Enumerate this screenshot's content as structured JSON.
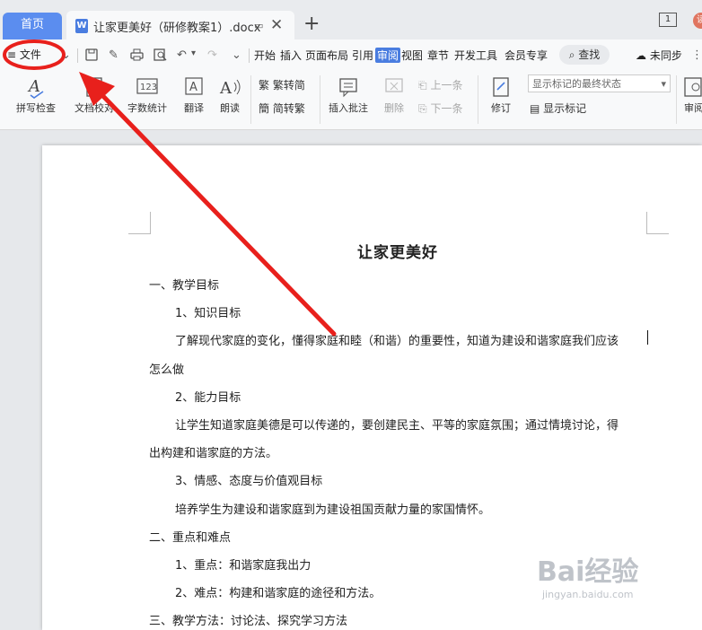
{
  "tabbar": {
    "home_label": "首页",
    "doc_icon_letter": "W",
    "doc_title": "让家更美好（研修教案1）.docx",
    "new_tab": "+",
    "window_count": "1",
    "avatar_letter": "读"
  },
  "menubar": {
    "file_label": "≡ 文件",
    "tabs": [
      "开始",
      "插入",
      "页面布局",
      "引用",
      "审阅",
      "视图",
      "章节",
      "开发工具",
      "会员专享"
    ],
    "search_label": "查找",
    "sync_label": "未同步"
  },
  "ribbon": {
    "spellcheck": "拼写检查",
    "doc_proof": "文档校对",
    "word_count": "字数统计",
    "translate": "翻译",
    "read_aloud": "朗读",
    "trad_to_simp": "繁转简",
    "simp_to_trad": "简转繁",
    "insert_comment": "插入批注",
    "delete": "删除",
    "prev": "上一条",
    "next": "下一条",
    "revise": "修订",
    "markup_state": "显示标记的最终状态",
    "show_markup": "显示标记",
    "review": "审阅"
  },
  "document": {
    "title": "让家更美好",
    "lines": [
      "一、教学目标",
      "1、知识目标",
      "了解现代家庭的变化，懂得家庭和睦（和谐）的重要性，知道为建设和谐家庭我们应该",
      "怎么做",
      "2、能力目标",
      "让学生知道家庭美德是可以传递的，要创建民主、平等的家庭氛围；通过情境讨论，得",
      "出构建和谐家庭的方法。",
      "3、情感、态度与价值观目标",
      "培养学生为建设和谐家庭到为建设祖国贡献力量的家国情怀。",
      "二、重点和难点",
      "1、重点：和谐家庭我出力",
      "2、难点：构建和谐家庭的途径和方法。",
      "三、教学方法：讨论法、探究学习方法"
    ]
  },
  "watermark": {
    "brand": "Bai经验",
    "url": "jingyan.baidu.com"
  },
  "colors": {
    "accent": "#4a7de0",
    "home_tab": "#5b8def",
    "annotation": "#e8201c"
  }
}
